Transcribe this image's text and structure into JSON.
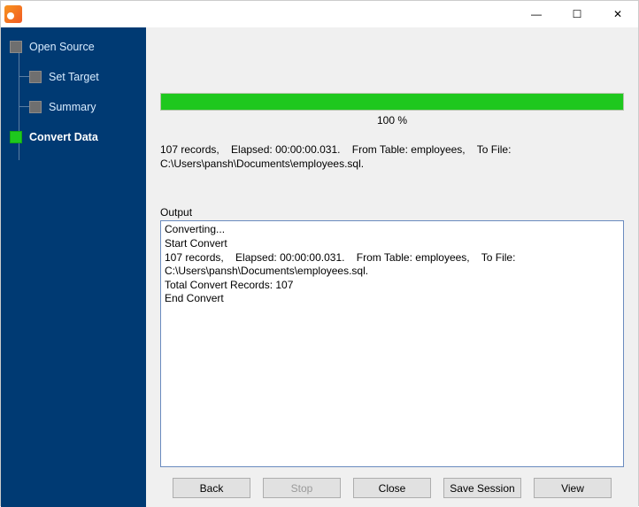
{
  "window": {
    "minimize_glyph": "—",
    "maximize_glyph": "☐",
    "close_glyph": "✕"
  },
  "sidebar": {
    "steps": [
      {
        "label": "Open Source"
      },
      {
        "label": "Set Target"
      },
      {
        "label": "Summary"
      },
      {
        "label": "Convert Data",
        "active": true
      }
    ]
  },
  "progress": {
    "percent_text": "100 %",
    "percent_value": 100
  },
  "status_line": "107 records,    Elapsed: 00:00:00.031.    From Table: employees,    To File: C:\\Users\\pansh\\Documents\\employees.sql.",
  "output": {
    "label": "Output",
    "text": "Converting...\nStart Convert\n107 records,    Elapsed: 00:00:00.031.    From Table: employees,    To File: C:\\Users\\pansh\\Documents\\employees.sql.\nTotal Convert Records: 107\nEnd Convert\n"
  },
  "buttons": {
    "back": "Back",
    "stop": "Stop",
    "close": "Close",
    "save_session": "Save Session",
    "view": "View"
  }
}
